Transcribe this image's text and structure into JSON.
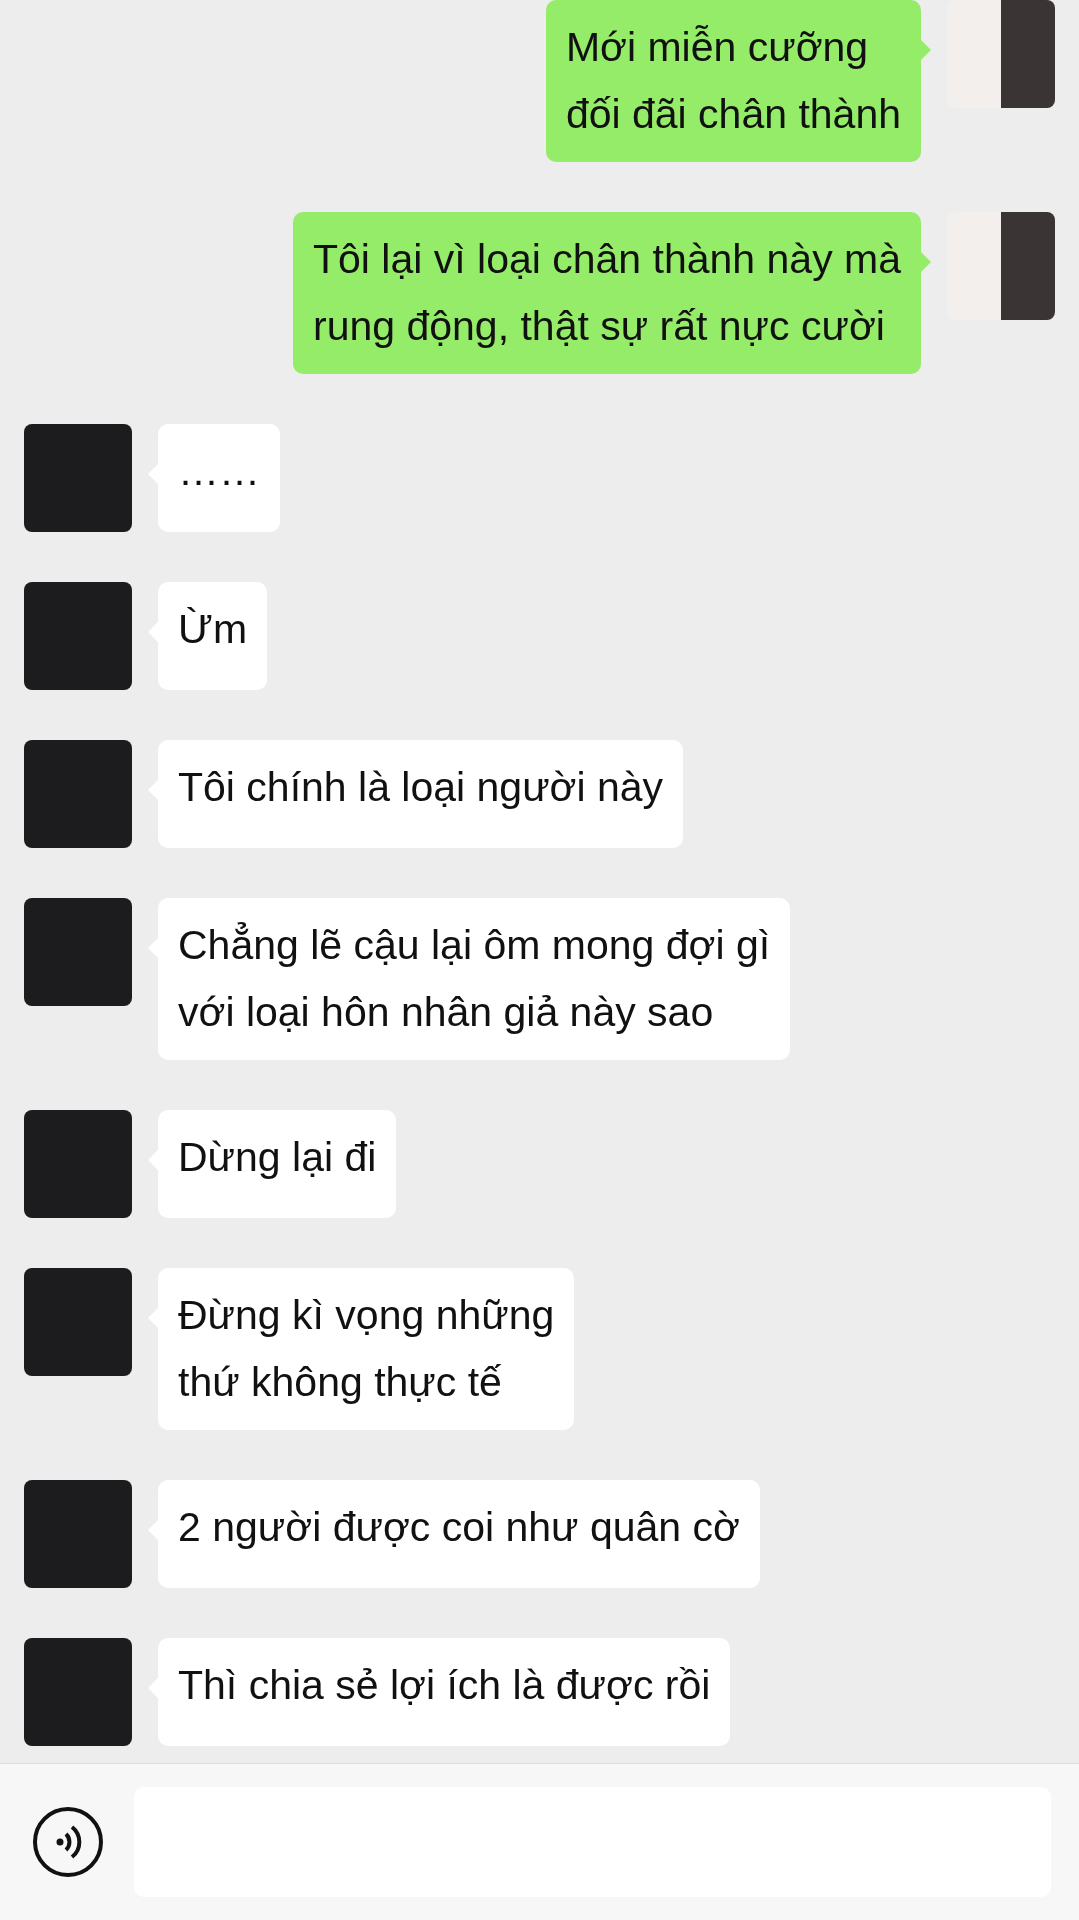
{
  "messages": [
    {
      "kind": "sent",
      "text": "Mới miễn cưỡng\nđối đãi chân thành"
    },
    {
      "kind": "sent",
      "text": "Tôi lại vì loại chân thành này mà\nrung động, thật sự rất nực cười"
    },
    {
      "kind": "received",
      "text": "……"
    },
    {
      "kind": "received",
      "text": "Ừm"
    },
    {
      "kind": "received",
      "text": "Tôi chính là loại người này"
    },
    {
      "kind": "received",
      "text": "Chẳng lẽ cậu lại ôm mong đợi gì\nvới loại hôn nhân giả này sao"
    },
    {
      "kind": "received",
      "text": "Dừng lại đi"
    },
    {
      "kind": "received",
      "text": "Đừng kì vọng những\nthứ không thực tế"
    },
    {
      "kind": "received",
      "text": "2 người được coi như quân cờ"
    },
    {
      "kind": "received",
      "text": "Thì chia sẻ lợi ích là được rồi"
    }
  ]
}
